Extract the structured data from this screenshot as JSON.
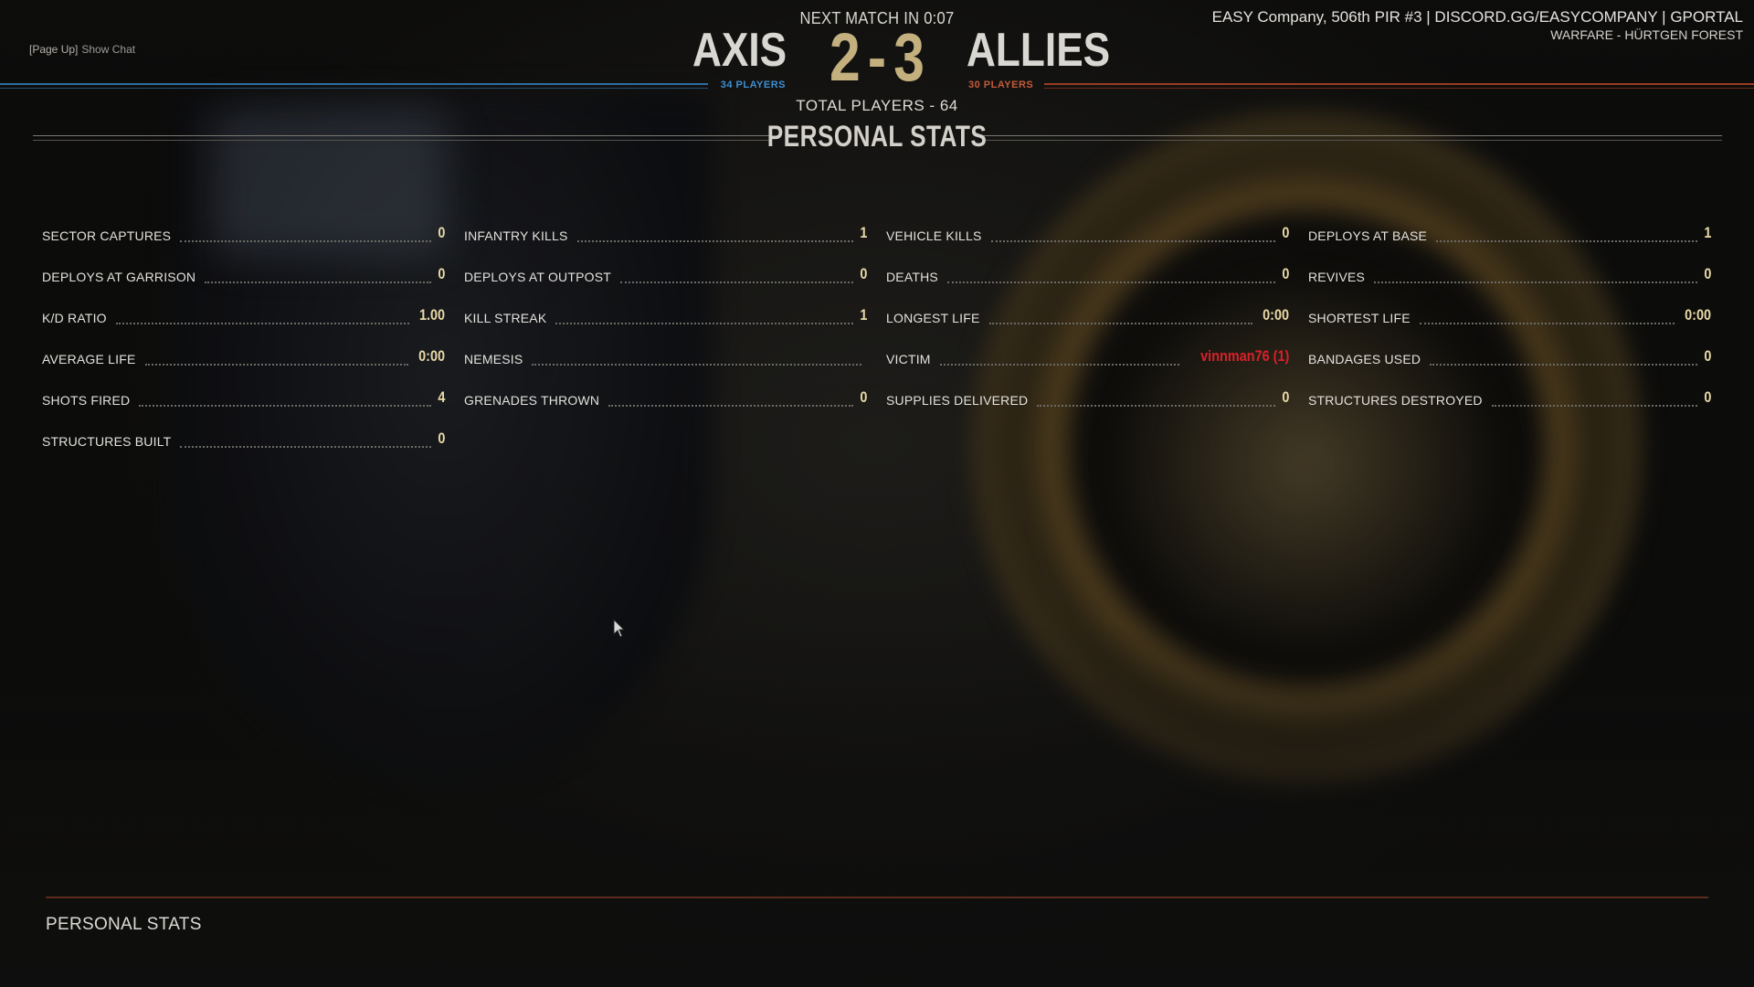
{
  "header": {
    "chat_key": "[Page Up]",
    "chat_label": "Show Chat",
    "next_match": "NEXT MATCH IN 0:07",
    "axis_name": "AXIS",
    "allies_name": "ALLIES",
    "axis_score": "2",
    "score_separator": "-",
    "allies_score": "3",
    "axis_players": "34 PLAYERS",
    "allies_players": "30 PLAYERS",
    "total_players": "TOTAL PLAYERS - 64",
    "server_name": "EASY Company, 506th PIR #3 | DISCORD.GG/EASYCOMPANY | GPORTAL",
    "map_name": "WARFARE - HÜRTGEN FOREST"
  },
  "colors": {
    "axis_accent": "#3d8fd1",
    "allies_accent": "#c45a3a",
    "score_gold": "#c4b07e",
    "value_gold": "#e9d9a8",
    "victim_red": "#d8202a"
  },
  "section_title": "PERSONAL STATS",
  "stats": {
    "col1": [
      {
        "label": "SECTOR CAPTURES",
        "value": "0"
      },
      {
        "label": "DEPLOYS AT GARRISON",
        "value": "0"
      },
      {
        "label": "K/D RATIO",
        "value": "1.00"
      },
      {
        "label": "AVERAGE LIFE",
        "value": "0:00"
      },
      {
        "label": "SHOTS FIRED",
        "value": "4"
      },
      {
        "label": "STRUCTURES BUILT",
        "value": "0"
      }
    ],
    "col2": [
      {
        "label": "INFANTRY KILLS",
        "value": "1"
      },
      {
        "label": "DEPLOYS AT OUTPOST",
        "value": "0"
      },
      {
        "label": "KILL STREAK",
        "value": "1"
      },
      {
        "label": "NEMESIS",
        "value": ""
      },
      {
        "label": "GRENADES THROWN",
        "value": "0"
      }
    ],
    "col3": [
      {
        "label": "VEHICLE KILLS",
        "value": "0"
      },
      {
        "label": "DEATHS",
        "value": "0"
      },
      {
        "label": "LONGEST LIFE",
        "value": "0:00"
      },
      {
        "label": "VICTIM",
        "value": "vinnman76 (1)"
      },
      {
        "label": "SUPPLIES DELIVERED",
        "value": "0"
      }
    ],
    "col4": [
      {
        "label": "DEPLOYS AT BASE",
        "value": "1"
      },
      {
        "label": "REVIVES",
        "value": "0"
      },
      {
        "label": "SHORTEST LIFE",
        "value": "0:00"
      },
      {
        "label": "BANDAGES USED",
        "value": "0"
      },
      {
        "label": "STRUCTURES DESTROYED",
        "value": "0"
      }
    ]
  },
  "footer": {
    "tab_title": "PERSONAL STATS"
  },
  "icons": {
    "cursor": "mouse-pointer-icon"
  }
}
